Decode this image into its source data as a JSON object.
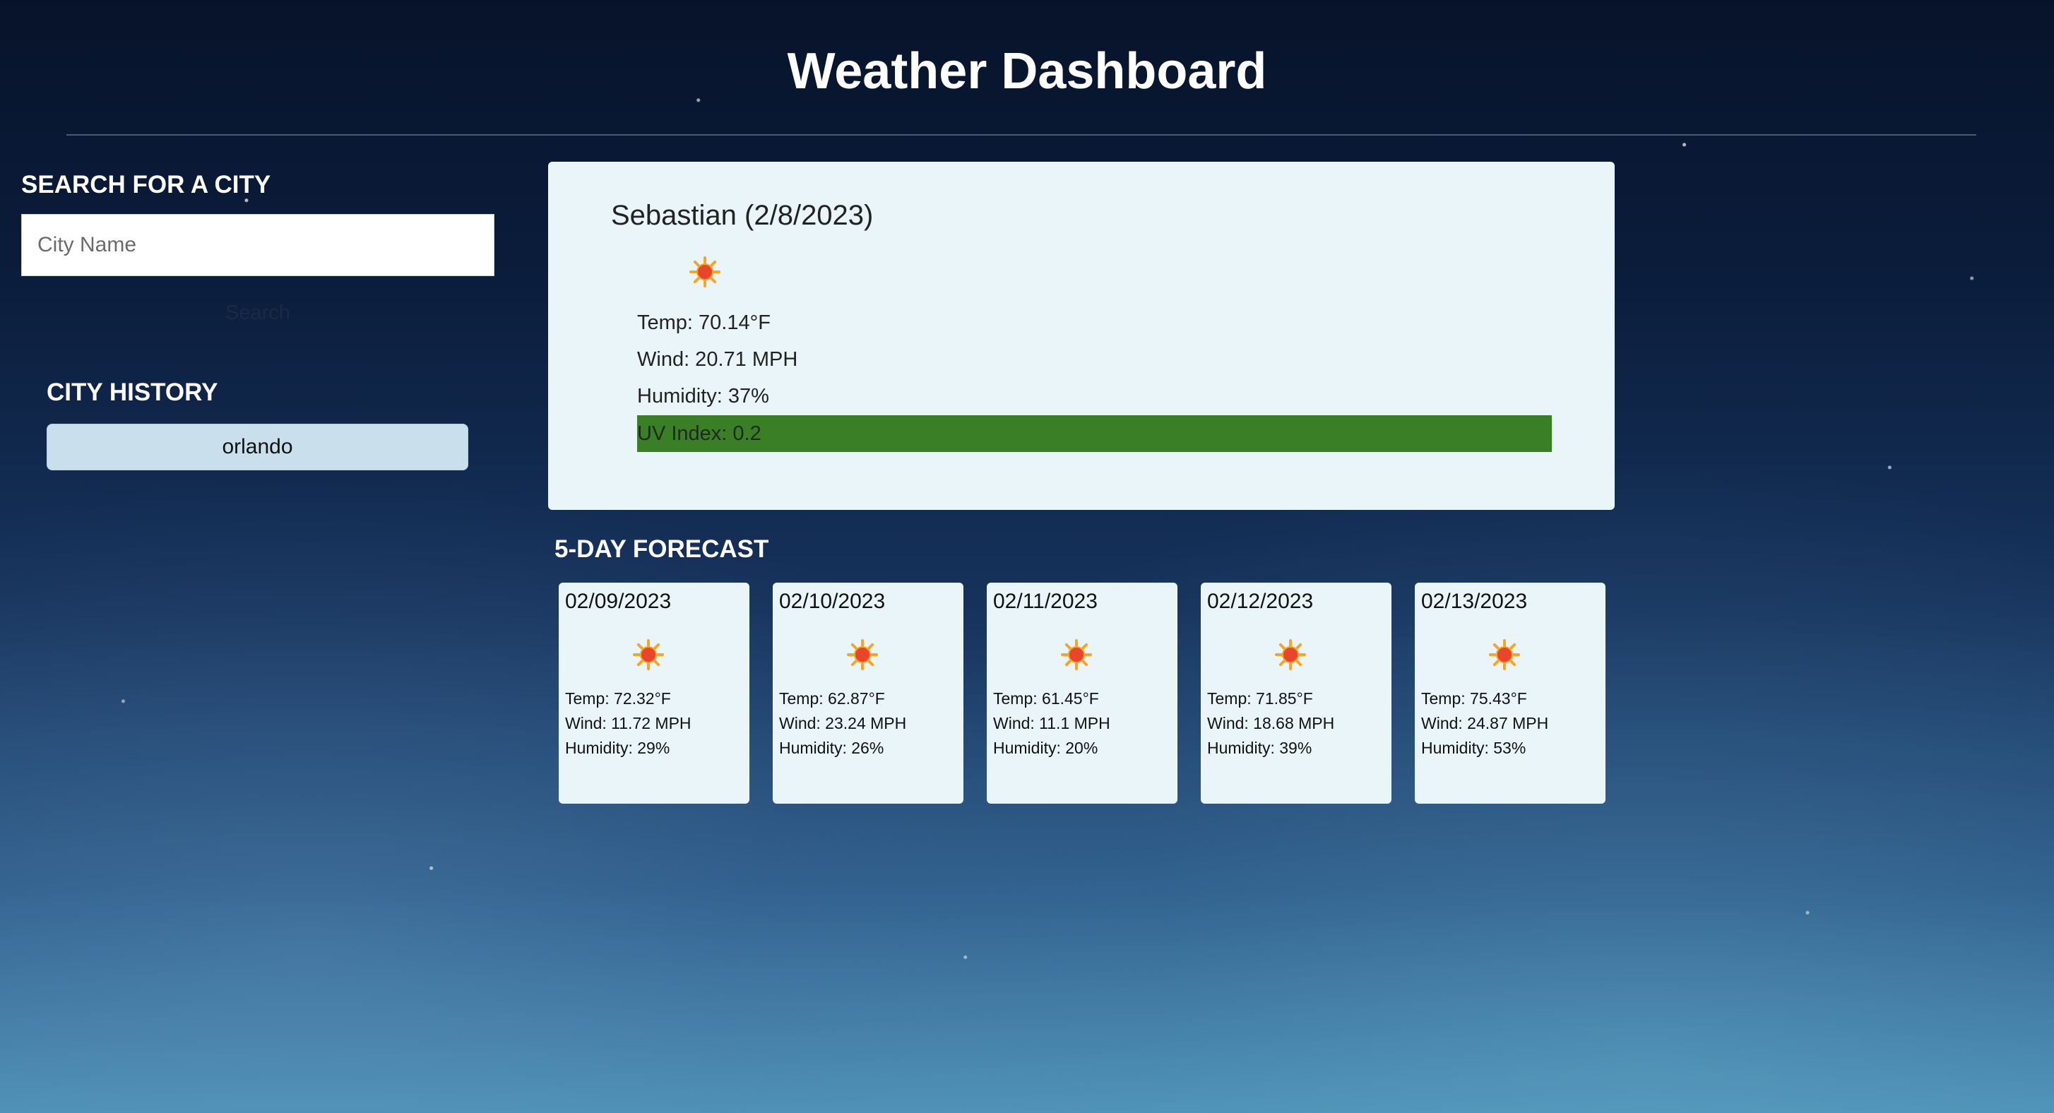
{
  "header": {
    "title": "Weather Dashboard"
  },
  "sidebar": {
    "search_heading": "SEARCH FOR A CITY",
    "search_placeholder": "City Name",
    "search_value": "",
    "search_button_label": "Search",
    "history_heading": "CITY HISTORY",
    "history": [
      "orlando"
    ]
  },
  "current": {
    "title": "Sebastian (2/8/2023)",
    "icon": "sun-icon",
    "temp": "Temp: 70.14°F",
    "wind": "Wind: 20.71 MPH",
    "humidity": "Humidity: 37%",
    "uv": "UV Index: 0.2",
    "uv_color": "#3a7e25"
  },
  "forecast": {
    "heading": "5-DAY FORECAST",
    "days": [
      {
        "date": "02/09/2023",
        "icon": "sun-icon",
        "temp": "Temp: 72.32°F",
        "wind": "Wind: 11.72 MPH",
        "humidity": "Humidity: 29%"
      },
      {
        "date": "02/10/2023",
        "icon": "sun-icon",
        "temp": "Temp: 62.87°F",
        "wind": "Wind: 23.24 MPH",
        "humidity": "Humidity: 26%"
      },
      {
        "date": "02/11/2023",
        "icon": "sun-icon",
        "temp": "Temp: 61.45°F",
        "wind": "Wind: 11.1 MPH",
        "humidity": "Humidity: 20%"
      },
      {
        "date": "02/12/2023",
        "icon": "sun-icon",
        "temp": "Temp: 71.85°F",
        "wind": "Wind: 18.68 MPH",
        "humidity": "Humidity: 39%"
      },
      {
        "date": "02/13/2023",
        "icon": "sun-icon",
        "temp": "Temp: 75.43°F",
        "wind": "Wind: 24.87 MPH",
        "humidity": "Humidity: 53%"
      }
    ]
  },
  "colors": {
    "card_background": "#eaf5f9",
    "history_button": "#c9e0ec",
    "sun_core": "#e8452c",
    "sun_rays": "#f5a623"
  }
}
